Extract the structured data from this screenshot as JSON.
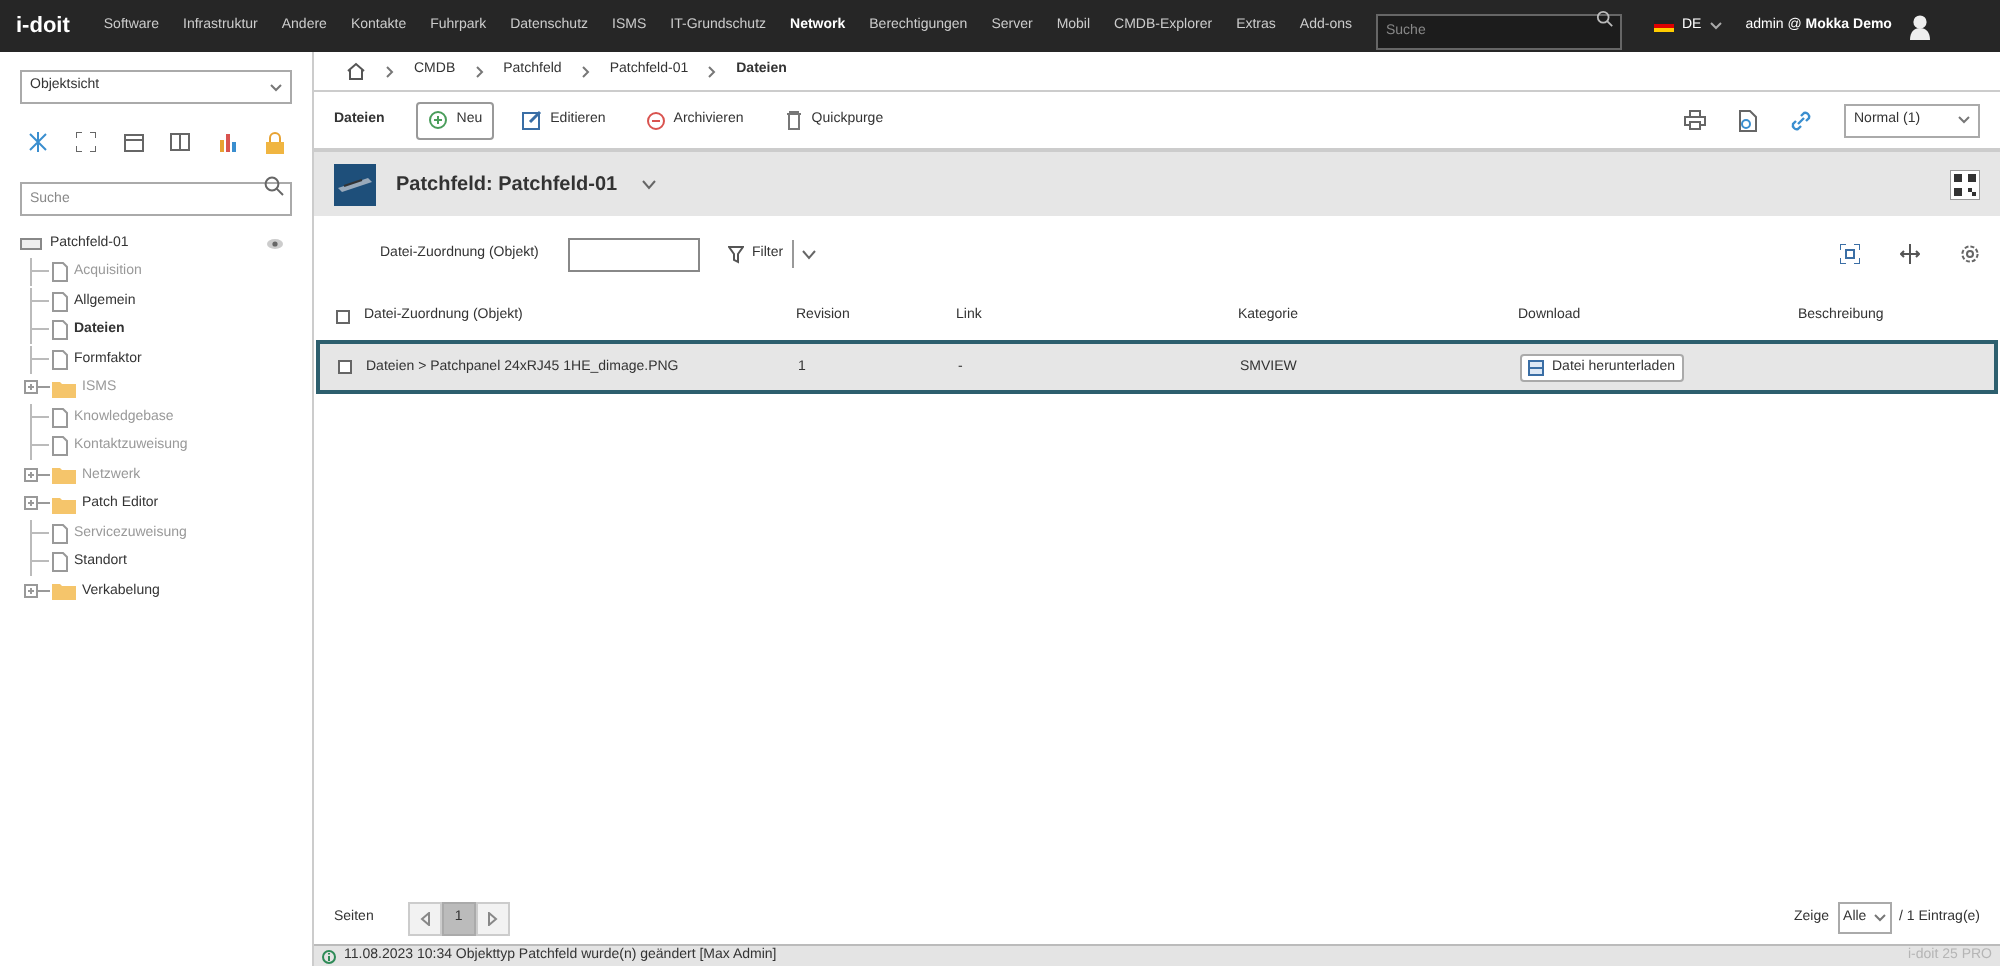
{
  "logo": "i-doit",
  "nav": [
    {
      "label": "Software",
      "selected": false
    },
    {
      "label": "Infrastruktur",
      "selected": false
    },
    {
      "label": "Andere",
      "selected": false
    },
    {
      "label": "Kontakte",
      "selected": false
    },
    {
      "label": "Fuhrpark",
      "selected": false
    },
    {
      "label": "Datenschutz",
      "selected": false
    },
    {
      "label": "ISMS",
      "selected": false
    },
    {
      "label": "IT-Grundschutz",
      "selected": false
    },
    {
      "label": "Network",
      "selected": true
    },
    {
      "label": "Berechtigungen",
      "selected": false
    },
    {
      "label": "Server",
      "selected": false
    },
    {
      "label": "Mobil",
      "selected": false
    },
    {
      "label": "CMDB-Explorer",
      "selected": false
    },
    {
      "label": "Extras",
      "selected": false
    },
    {
      "label": "Add-ons",
      "selected": false
    }
  ],
  "search": {
    "placeholder": "Suche"
  },
  "language": "DE",
  "user": {
    "name": "admin",
    "tenant": "Mokka Demo",
    "separator": "@"
  },
  "sidebar": {
    "view": "Objektsicht",
    "search_placeholder": "Suche",
    "tree": {
      "label": "Patchfeld-01",
      "children": [
        {
          "label": "Acquisition",
          "kind": "file",
          "empty": true,
          "selected": false
        },
        {
          "label": "Allgemein",
          "kind": "file",
          "empty": false,
          "selected": false
        },
        {
          "label": "Dateien",
          "kind": "file",
          "empty": false,
          "selected": true
        },
        {
          "label": "Formfaktor",
          "kind": "file",
          "empty": false,
          "selected": false
        },
        {
          "label": "ISMS",
          "kind": "folder",
          "empty": true,
          "selected": false
        },
        {
          "label": "Knowledgebase",
          "kind": "file",
          "empty": true,
          "selected": false
        },
        {
          "label": "Kontaktzuweisung",
          "kind": "file",
          "empty": true,
          "selected": false
        },
        {
          "label": "Netzwerk",
          "kind": "folder",
          "empty": true,
          "selected": false
        },
        {
          "label": "Patch Editor",
          "kind": "folder",
          "empty": false,
          "selected": false
        },
        {
          "label": "Servicezuweisung",
          "kind": "file",
          "empty": true,
          "selected": false
        },
        {
          "label": "Standort",
          "kind": "file",
          "empty": false,
          "selected": false
        },
        {
          "label": "Verkabelung",
          "kind": "folder",
          "empty": false,
          "selected": false
        }
      ]
    }
  },
  "breadcrumb": [
    "CMDB",
    "Patchfeld",
    "Patchfeld-01",
    "Dateien"
  ],
  "toolbar": {
    "title": "Dateien",
    "buttons": [
      {
        "label": "Neu",
        "kind": "new",
        "selected": true
      },
      {
        "label": "Editieren",
        "kind": "edit",
        "selected": false
      },
      {
        "label": "Archivieren",
        "kind": "archive",
        "selected": false
      },
      {
        "label": "Quickpurge",
        "kind": "purge",
        "selected": false
      }
    ],
    "status_select": "Normal (1)"
  },
  "object_title": "Patchfeld: Patchfeld-01",
  "filter": {
    "label": "Datei-Zuordnung (Objekt)",
    "button": "Filter"
  },
  "table": {
    "select_all_checked": false,
    "columns": [
      "Datei-Zuordnung (Objekt)",
      "Revision",
      "Link",
      "Kategorie",
      "Download",
      "Beschreibung"
    ],
    "rows": [
      {
        "selected": true,
        "checked": false,
        "cells": [
          "Dateien > Patchpanel 24xRJ45 1HE_dimage.PNG",
          "1",
          "-",
          "SMVIEW"
        ],
        "download": "Datei herunterladen"
      }
    ]
  },
  "pagination": {
    "label": "Seiten",
    "page": "1",
    "show_label": "Zeige",
    "show_value": "Alle",
    "count": "/ 1 Eintrag(e)"
  },
  "status_bar": {
    "message": "11.08.2023 10:34 Objekttyp Patchfeld wurde(n) geändert [Max Admin]",
    "version": "i-doit 25 PRO"
  }
}
